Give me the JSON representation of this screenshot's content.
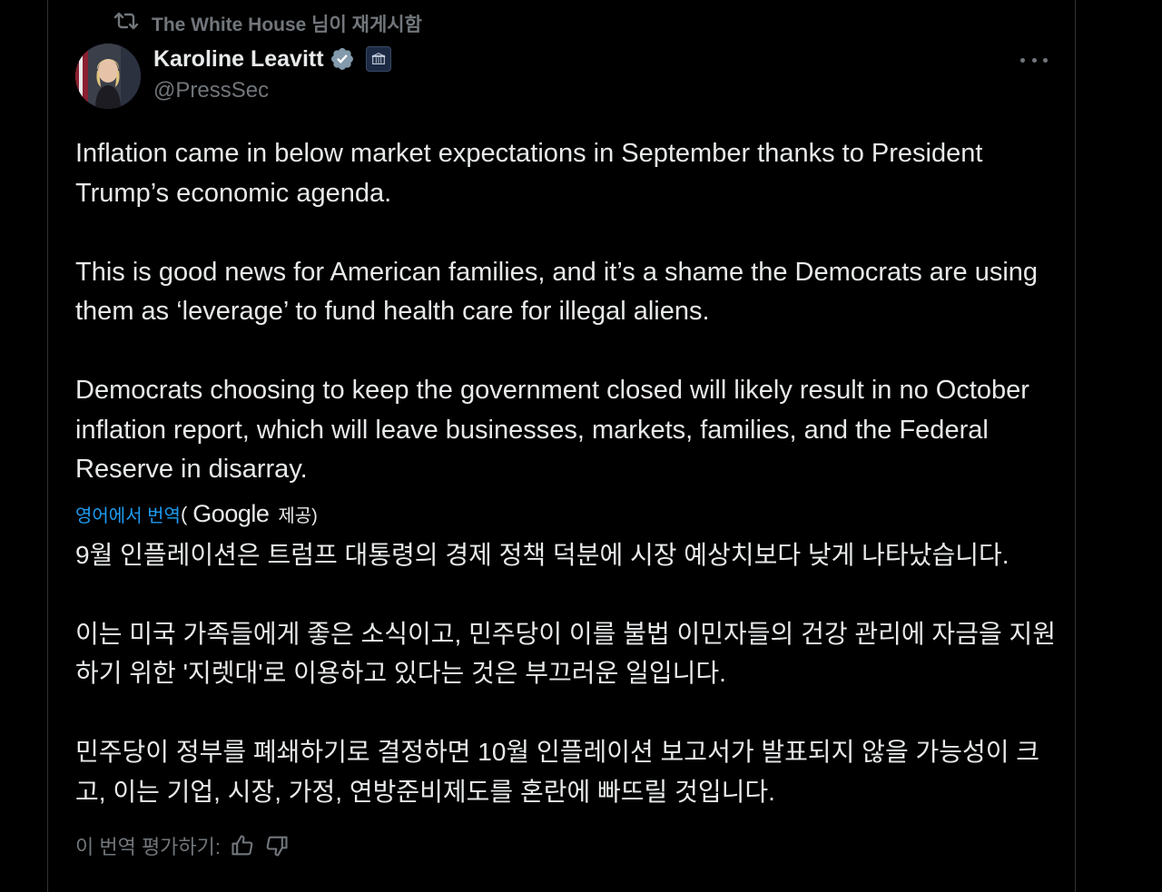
{
  "repost": {
    "label": "The White House 님이 재게시함",
    "icon": "repost-icon"
  },
  "author": {
    "name": "Karoline Leavitt",
    "handle": "@PressSec",
    "verified_icon": "verified-badge-icon",
    "affiliation_icon": "white-house-affiliation-icon"
  },
  "more_icon": "more-options-icon",
  "tweet": {
    "paragraphs": [
      "Inflation came in below market expectations in September thanks to President Trump’s economic agenda.",
      "This is good news for American families, and it’s a shame the Democrats are using them as ‘leverage’ to fund health care for illegal aliens.",
      "Democrats choosing to keep the government closed will likely result in no October inflation report, which will leave businesses, markets, families, and the Federal Reserve in disarray."
    ]
  },
  "translation": {
    "link_label": "영어에서 번역",
    "open_paren": "(",
    "provider": "Google",
    "provided_label": "제공)",
    "paragraphs": [
      "9월 인플레이션은 트럼프 대통령의 경제 정책 덕분에 시장 예상치보다 낮게 나타났습니다.",
      "이는 미국 가족들에게 좋은 소식이고, 민주당이 이를 불법 이민자들의 건강 관리에 자금을 지원하기 위한 '지렛대'로 이용하고 있다는 것은 부끄러운 일입니다.",
      "민주당이 정부를 폐쇄하기로 결정하면 10월 인플레이션 보고서가 발표되지 않을 가능성이 크고, 이는 기업, 시장, 가정, 연방준비제도를 혼란에 빠뜨릴 것입니다."
    ],
    "rate_label": "이 번역 평가하기:",
    "thumbs_up_icon": "thumbs-up-icon",
    "thumbs_down_icon": "thumbs-down-icon"
  },
  "colors": {
    "background": "#000000",
    "text": "#e7e9ea",
    "muted": "#71767b",
    "link": "#1d9bf0",
    "verified": "#829aab"
  }
}
